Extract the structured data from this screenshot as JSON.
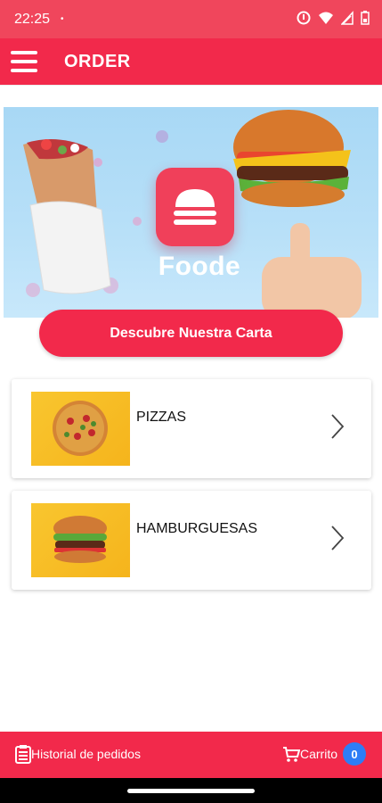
{
  "status": {
    "time": "22:25",
    "dot": "•"
  },
  "header": {
    "title": "ORDER",
    "menu_icon": "hamburger-menu-icon"
  },
  "banner": {
    "brand": "Foode"
  },
  "carta_button": {
    "label": "Descubre Nuestra Carta"
  },
  "categories": [
    {
      "name": "PIZZAS",
      "icon": "pizza-image"
    },
    {
      "name": "HAMBURGUESAS",
      "icon": "burger-image"
    }
  ],
  "bottom_nav": {
    "history_label": "Historial de pedidos",
    "cart_label": "Carrito",
    "cart_count": "0"
  },
  "colors": {
    "primary": "#f2294b",
    "badge": "#2d7df6",
    "status_bar": "#f0465c"
  }
}
